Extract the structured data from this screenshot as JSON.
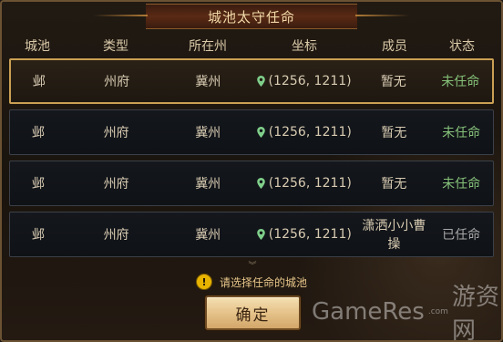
{
  "dialog": {
    "title": "城池太守任命"
  },
  "columns": [
    "城池",
    "类型",
    "所在州",
    "坐标",
    "成员",
    "状态"
  ],
  "rows": [
    {
      "city": "邺",
      "type": "州府",
      "province": "冀州",
      "coord": "(1256, 1211)",
      "member": "暂无",
      "status": "未任命",
      "status_tone": "green",
      "selected": true
    },
    {
      "city": "邺",
      "type": "州府",
      "province": "冀州",
      "coord": "(1256, 1211)",
      "member": "暂无",
      "status": "未任命",
      "status_tone": "green",
      "selected": false
    },
    {
      "city": "邺",
      "type": "州府",
      "province": "冀州",
      "coord": "(1256, 1211)",
      "member": "暂无",
      "status": "未任命",
      "status_tone": "green",
      "selected": false
    },
    {
      "city": "邺",
      "type": "州府",
      "province": "冀州",
      "coord": "(1256, 1211)",
      "member": "潇洒小小曹操",
      "status": "已任命",
      "status_tone": "gray",
      "selected": false
    }
  ],
  "tip": {
    "icon": "warning-icon",
    "text": "请选择任命的城池"
  },
  "confirm_label": "确定",
  "watermark": {
    "latin": "GameRes",
    "com": ".com",
    "cn": "游资网"
  },
  "colors": {
    "status_green": "#86c27a",
    "status_gray": "#a7a7a7",
    "selected_border": "#caa054"
  }
}
